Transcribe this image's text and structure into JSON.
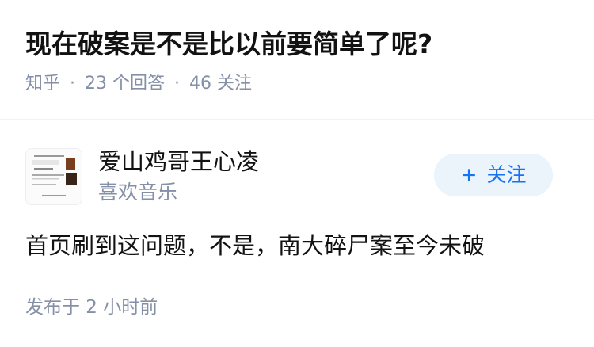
{
  "question": {
    "title": "现在破案是不是比以前要简单了呢?",
    "meta": {
      "source": "知乎",
      "answers": "23 个回答",
      "followers": "46 关注"
    }
  },
  "answer": {
    "author": {
      "name": "爱山鸡哥王心凌",
      "bio": "喜欢音乐",
      "follow_label": "关注"
    },
    "content": "首页刷到这问题，不是，南大碎尸案至今未破",
    "time": "发布于 2 小时前"
  }
}
